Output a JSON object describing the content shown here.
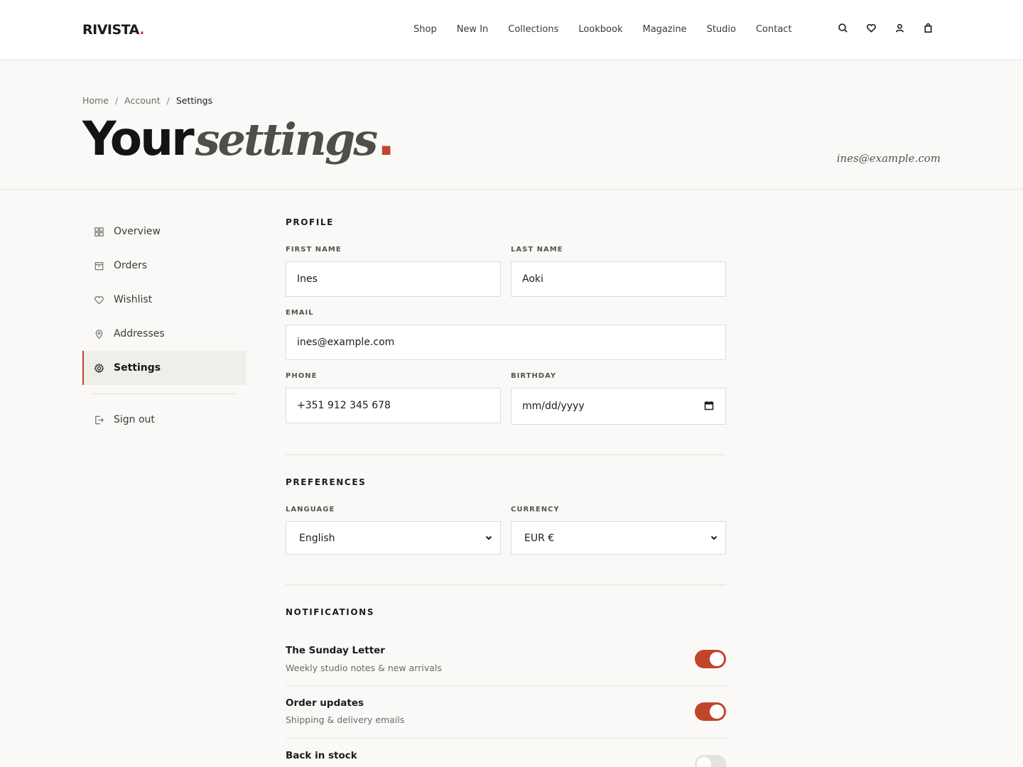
{
  "brand": {
    "name": "RIVISTA",
    "dot": ".",
    "accent": "#c0452a"
  },
  "nav": [
    "Shop",
    "New In",
    "Collections",
    "Lookbook",
    "Magazine",
    "Studio",
    "Contact"
  ],
  "header_icons": [
    "search-icon",
    "heart-icon",
    "user-icon",
    "bag-icon"
  ],
  "breadcrumb": {
    "home": "Home",
    "account": "Account",
    "current": "Settings",
    "sep": "/"
  },
  "hero": {
    "title_a": "Your",
    "title_b": "settings",
    "title_dot": ".",
    "email": "ines@example.com"
  },
  "sidebar": {
    "items": [
      {
        "label": "Overview",
        "icon": "grid-icon"
      },
      {
        "label": "Orders",
        "icon": "box-icon"
      },
      {
        "label": "Wishlist",
        "icon": "heart-icon"
      },
      {
        "label": "Addresses",
        "icon": "pin-icon"
      },
      {
        "label": "Settings",
        "icon": "gear-icon",
        "active": true
      }
    ],
    "sign_out": "Sign out"
  },
  "profile": {
    "title": "PROFILE",
    "first_name_label": "FIRST NAME",
    "first_name": "Ines",
    "last_name_label": "LAST NAME",
    "last_name": "Aoki",
    "email_label": "EMAIL",
    "email": "ines@example.com",
    "phone_label": "PHONE",
    "phone": "+351 912 345 678",
    "birthday_label": "BIRTHDAY",
    "birthday_placeholder": "mm/dd/yyyy"
  },
  "preferences": {
    "title": "PREFERENCES",
    "language_label": "LANGUAGE",
    "language": "English",
    "currency_label": "CURRENCY",
    "currency": "EUR €"
  },
  "notifications": {
    "title": "NOTIFICATIONS",
    "items": [
      {
        "title": "The Sunday Letter",
        "sub": "Weekly studio notes & new arrivals",
        "on": true
      },
      {
        "title": "Order updates",
        "sub": "Shipping & delivery emails",
        "on": true
      },
      {
        "title": "Back in stock",
        "sub": "",
        "on": false
      }
    ]
  }
}
